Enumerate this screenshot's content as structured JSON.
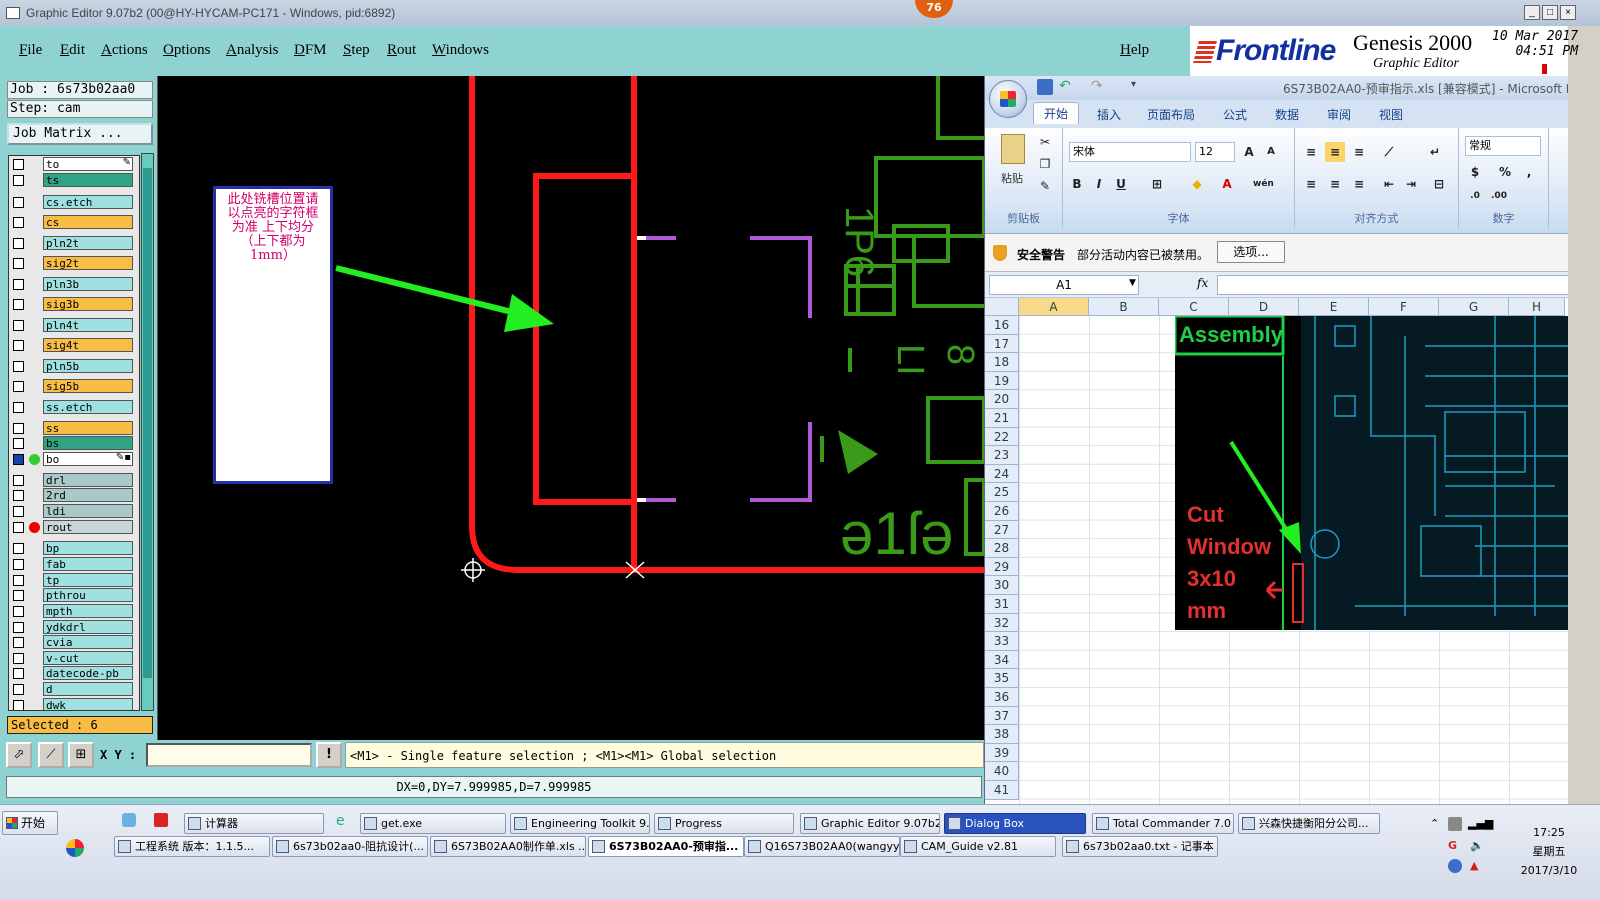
{
  "window": {
    "title": "Graphic Editor 9.07b2 (00@HY-HYCAM-PC171 - Windows, pid:6892)",
    "badge": "76",
    "min": "_",
    "max": "□",
    "close": "×"
  },
  "menu": {
    "items": [
      "File",
      "Edit",
      "Actions",
      "Options",
      "Analysis",
      "DFM",
      "Step",
      "Rout",
      "Windows"
    ],
    "help": "Help"
  },
  "brand": {
    "logo": "Frontline",
    "product": "Genesis 2000",
    "subtitle": "Graphic Editor",
    "date": "10 Mar 2017",
    "time": "04:51 PM"
  },
  "job": {
    "job_line": "Job : 6s73b02aa0",
    "step_line": "Step: cam",
    "matrix_btn": "Job Matrix ..."
  },
  "layers": [
    {
      "name": "to",
      "color": "#ffffff",
      "flag": "✎"
    },
    {
      "name": "ts",
      "color": "#2fa383"
    },
    {
      "name": "cs.etch",
      "color": "#9fe0e0"
    },
    {
      "name": "cs",
      "color": "#f7bd45"
    },
    {
      "name": "pln2t",
      "color": "#9fe0e0"
    },
    {
      "name": "sig2t",
      "color": "#f7bd45"
    },
    {
      "name": "pln3b",
      "color": "#9fe0e0"
    },
    {
      "name": "sig3b",
      "color": "#f7bd45"
    },
    {
      "name": "pln4t",
      "color": "#9fe0e0"
    },
    {
      "name": "sig4t",
      "color": "#f7bd45"
    },
    {
      "name": "pln5b",
      "color": "#9fe0e0"
    },
    {
      "name": "sig5b",
      "color": "#f7bd45"
    },
    {
      "name": "ss.etch",
      "color": "#9fe0e0"
    },
    {
      "name": "ss",
      "color": "#f7bd45"
    },
    {
      "name": "bs",
      "color": "#2fa383"
    },
    {
      "name": "bo",
      "color": "#ffffff",
      "flag": "✎▪"
    },
    {
      "name": "drl",
      "color": "#a9c8c8"
    },
    {
      "name": "2rd",
      "color": "#a9c8c8"
    },
    {
      "name": "ldi",
      "color": "#a9c8c8"
    },
    {
      "name": "rout",
      "color": "#c9d6d6"
    },
    {
      "name": "bp",
      "color": "#9fe0e0"
    },
    {
      "name": "fab",
      "color": "#9fe0e0"
    },
    {
      "name": "tp",
      "color": "#9fe0e0"
    },
    {
      "name": "pthrou",
      "color": "#9fe0e0"
    },
    {
      "name": "mpth",
      "color": "#9fe0e0"
    },
    {
      "name": "ydkdrl",
      "color": "#9fe0e0"
    },
    {
      "name": "cvia",
      "color": "#9fe0e0"
    },
    {
      "name": "v-cut",
      "color": "#9fe0e0"
    },
    {
      "name": "datecode-pb",
      "color": "#9fe0e0"
    },
    {
      "name": "d",
      "color": "#9fe0e0"
    },
    {
      "name": "dwk",
      "color": "#9fe0e0"
    }
  ],
  "selected": "Selected : 6",
  "annotation": "此处铣槽位置请以点亮的字符框为准 上下均分（上下都为1mm）",
  "bottom": {
    "xy_label": "X Y :",
    "xy_value": "",
    "info_btn": "!",
    "help_msg": "<M1> - Single feature selection ; <M1><M1> Global selection",
    "status": "DX=0,DY=7.999985,D=7.999985"
  },
  "excel": {
    "title": "6S73B02AA0-预审指示.xls [兼容模式] - Microsoft E",
    "tabs": [
      "开始",
      "插入",
      "页面布局",
      "公式",
      "数据",
      "审阅",
      "视图"
    ],
    "font_name": "宋体",
    "font_size": "12",
    "number_format": "常规",
    "paste": "粘贴",
    "groups": [
      "剪贴板",
      "字体",
      "对齐方式",
      "数字"
    ],
    "warn_title": "安全警告",
    "warn_text": "部分活动内容已被禁用。",
    "warn_btn": "选项...",
    "name_box": "A1",
    "fx": "fx",
    "cols": [
      "A",
      "B",
      "C",
      "D",
      "E",
      "F",
      "G",
      "H"
    ],
    "rows": [
      "16",
      "17",
      "18",
      "19",
      "20",
      "21",
      "22",
      "23",
      "24",
      "25",
      "26",
      "27",
      "28",
      "29",
      "30",
      "31",
      "32",
      "33",
      "34",
      "35",
      "36",
      "37",
      "38",
      "39",
      "40",
      "41"
    ],
    "assembly": "Assembly",
    "cut_text": [
      "Cut",
      "Window",
      "3x10",
      "mm"
    ]
  },
  "taskbar": {
    "start": "开始",
    "row1": [
      "计算器",
      "get.exe",
      "Engineering Toolkit 9....",
      "Progress",
      "Graphic Editor 9.07b2 ...",
      "Dialog Box",
      "Total Commander 7.0 ...",
      "兴森快捷衡阳分公司..."
    ],
    "row2": [
      "工程系统  版本：1.1.5...",
      "6s73b02aa0-阻抗设计(...",
      "6S73B02AA0制作单.xls ...",
      "6S73B02AA0-预审指...",
      "Q16S73B02AA0(wangyy...",
      "CAM_Guide v2.81",
      "6s73b02aa0.txt - 记事本"
    ],
    "clock": "17:25",
    "weekday": "星期五",
    "date": "2017/3/10"
  }
}
